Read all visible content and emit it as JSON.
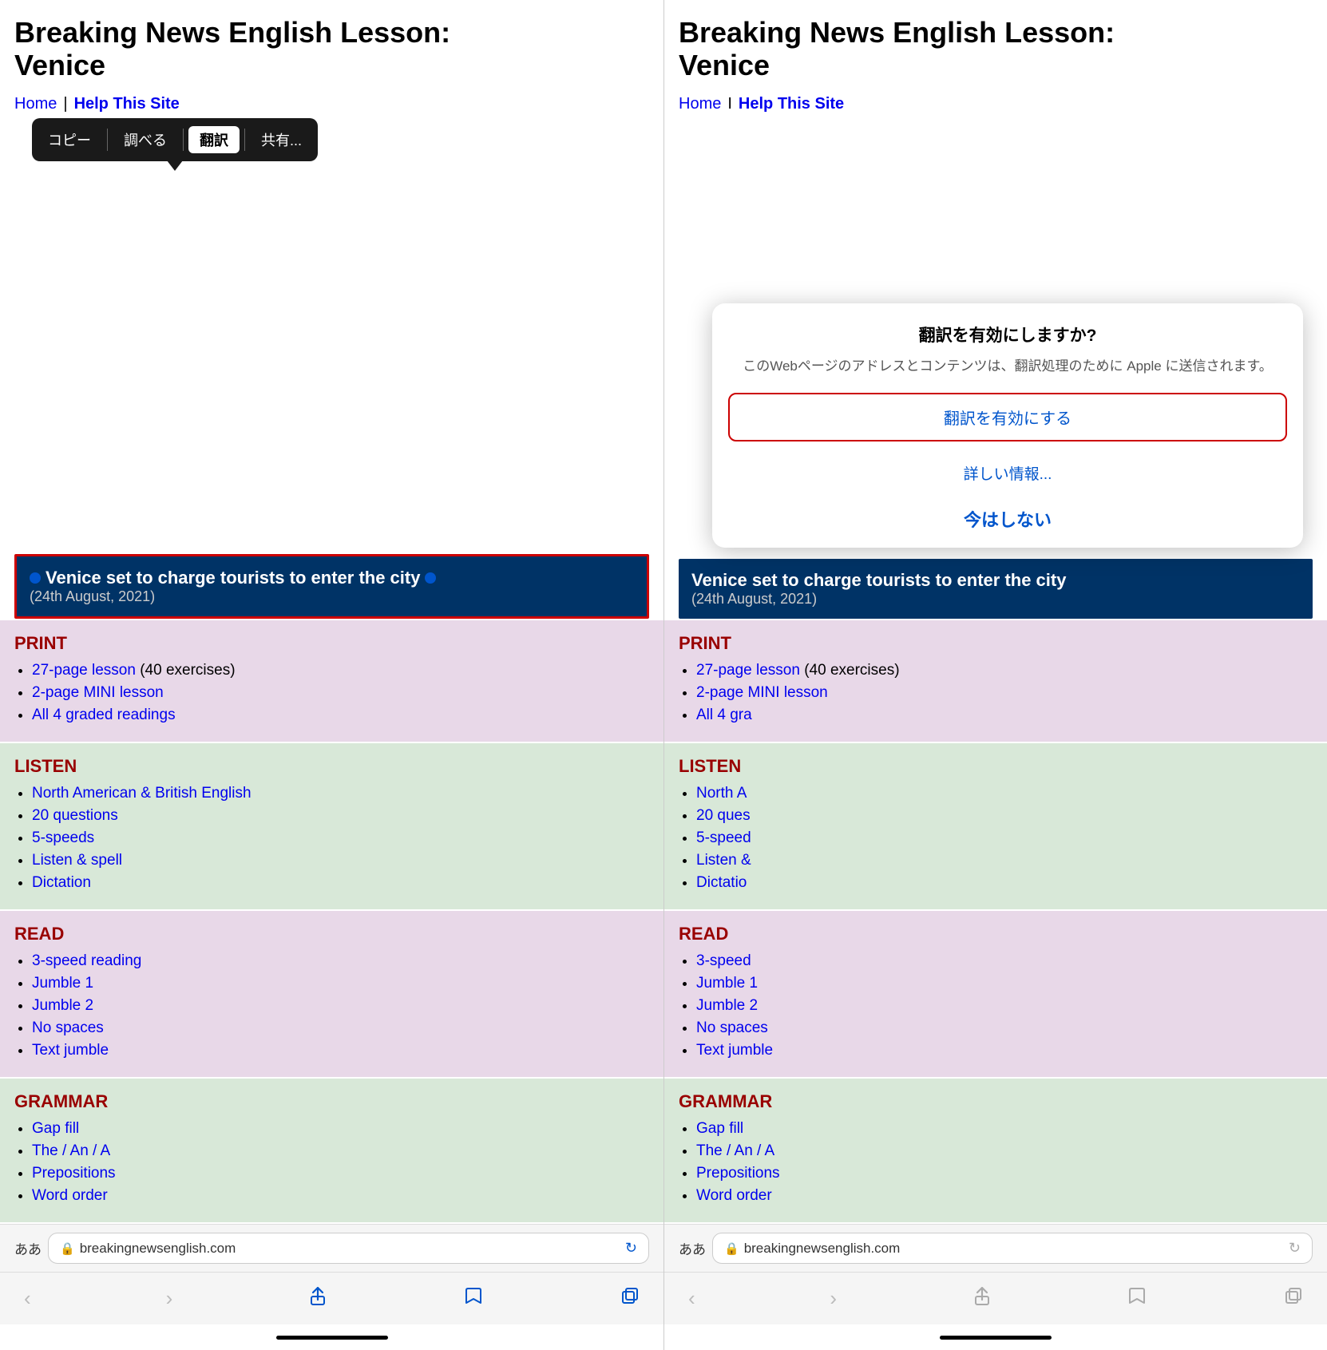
{
  "left_panel": {
    "title_line1": "Breaking News English Lesson:",
    "title_line2": "Venice",
    "nav": {
      "home": "Home",
      "separator": "|",
      "help": "Help This Site"
    },
    "context_menu": {
      "copy": "コピー",
      "lookup": "調べる",
      "translate": "翻訳",
      "share": "共有..."
    },
    "headline": {
      "text": "Venice set to charge tourists to enter the city",
      "date": "(24th August, 2021)"
    },
    "sections": {
      "print": {
        "heading": "PRINT",
        "items": [
          {
            "link": "27-page lesson",
            "suffix": " (40 exercises)"
          },
          {
            "link": "2-page MINI lesson",
            "suffix": ""
          },
          {
            "link": "All 4 graded readings",
            "suffix": ""
          }
        ]
      },
      "listen": {
        "heading": "LISTEN",
        "items": [
          {
            "link": "North American & British English",
            "suffix": ""
          },
          {
            "link": "20 questions",
            "suffix": ""
          },
          {
            "link": "5-speeds",
            "suffix": ""
          },
          {
            "link": "Listen & spell",
            "suffix": ""
          },
          {
            "link": "Dictation",
            "suffix": ""
          }
        ]
      },
      "read": {
        "heading": "READ",
        "items": [
          {
            "link": "3-speed reading",
            "suffix": ""
          },
          {
            "link": "Jumble 1",
            "suffix": ""
          },
          {
            "link": "Jumble 2",
            "suffix": ""
          },
          {
            "link": "No spaces",
            "suffix": ""
          },
          {
            "link": "Text jumble",
            "suffix": ""
          }
        ]
      },
      "grammar": {
        "heading": "GRAMMAR",
        "items": [
          {
            "link": "Gap fill",
            "suffix": ""
          },
          {
            "link": "The / An / A",
            "suffix": ""
          },
          {
            "link": "Prepositions",
            "suffix": ""
          },
          {
            "link": "Word order",
            "suffix": ""
          }
        ]
      }
    },
    "bottom_bar": {
      "aa": "ああ",
      "url": "breakingnewsenglish.com"
    }
  },
  "right_panel": {
    "title_line1": "Breaking News English Lesson:",
    "title_line2": "Venice",
    "nav": {
      "home": "Home",
      "separator": "I",
      "help": "Help This Site"
    },
    "headline": {
      "text": "Venice set to charge tourists to enter the city",
      "date": "(24th August, 2021)"
    },
    "sections": {
      "print": {
        "heading": "PRINT",
        "items": [
          {
            "link": "27-page lesson",
            "suffix": " (40 exercises)"
          },
          {
            "link": "2-page MINI lesson",
            "suffix": ""
          },
          {
            "link": "All 4 gra",
            "suffix": ""
          }
        ]
      },
      "listen": {
        "heading": "LISTEN",
        "items": [
          {
            "link": "North A",
            "suffix": ""
          },
          {
            "link": "20 ques",
            "suffix": ""
          },
          {
            "link": "5-speed",
            "suffix": ""
          },
          {
            "link": "Listen &",
            "suffix": ""
          },
          {
            "link": "Dictatio",
            "suffix": ""
          }
        ]
      },
      "read": {
        "heading": "READ",
        "items": [
          {
            "link": "3-speed",
            "suffix": ""
          },
          {
            "link": "Jumble 1",
            "suffix": ""
          },
          {
            "link": "Jumble 2",
            "suffix": ""
          },
          {
            "link": "No spaces",
            "suffix": ""
          },
          {
            "link": "Text jumble",
            "suffix": ""
          }
        ]
      },
      "grammar": {
        "heading": "GRAMMAR",
        "items": [
          {
            "link": "Gap fill",
            "suffix": ""
          },
          {
            "link": "The / An / A",
            "suffix": ""
          },
          {
            "link": "Prepositions",
            "suffix": ""
          },
          {
            "link": "Word order",
            "suffix": ""
          }
        ]
      }
    },
    "dialog": {
      "title": "翻訳を有効にしますか?",
      "body": "このWebページのアドレスとコンテンツは、翻訳処理のために Apple に送信されます。",
      "btn_enable": "翻訳を有効にする",
      "btn_more": "詳しい情報...",
      "btn_cancel": "今はしない"
    },
    "bottom_bar": {
      "aa": "ああ",
      "url": "breakingnewsenglish.com"
    }
  },
  "toolbar": {
    "back_label": "‹",
    "forward_label": "›",
    "share_label": "↑",
    "bookmarks_label": "⊏",
    "tabs_label": "⧉"
  }
}
